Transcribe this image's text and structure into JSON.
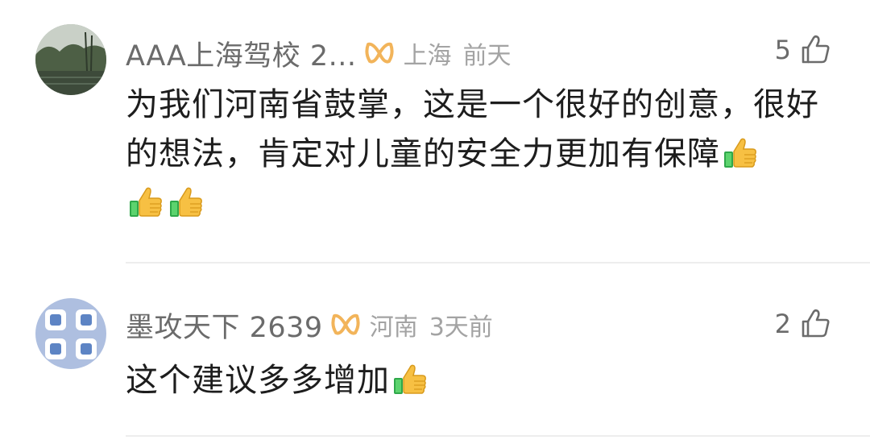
{
  "comments": [
    {
      "username": "AAA上海驾校 2...",
      "location": "上海",
      "time": "前天",
      "likes": "5",
      "text": "为我们河南省鼓掌，这是一个很好的创意，很好的想法，肯定对儿童的安全力更加有保障",
      "trailing_emoji_count": 3,
      "avatar_icon": "landscape-photo-avatar"
    },
    {
      "username": "墨攻天下 2639",
      "location": "河南",
      "time": "3天前",
      "likes": "2",
      "text": "这个建议多多增加",
      "trailing_emoji_count": 1,
      "avatar_icon": "app-icons-grid-avatar"
    }
  ],
  "colors": {
    "username": "#6b6b6b",
    "meta": "#a3a3a3",
    "vip_badge": "#f2b45a",
    "body_text": "#1d1d1d"
  },
  "icons": [
    "vip-badge-icon",
    "thumbs-up-outline-icon",
    "thumbs-up-emoji-icon"
  ]
}
